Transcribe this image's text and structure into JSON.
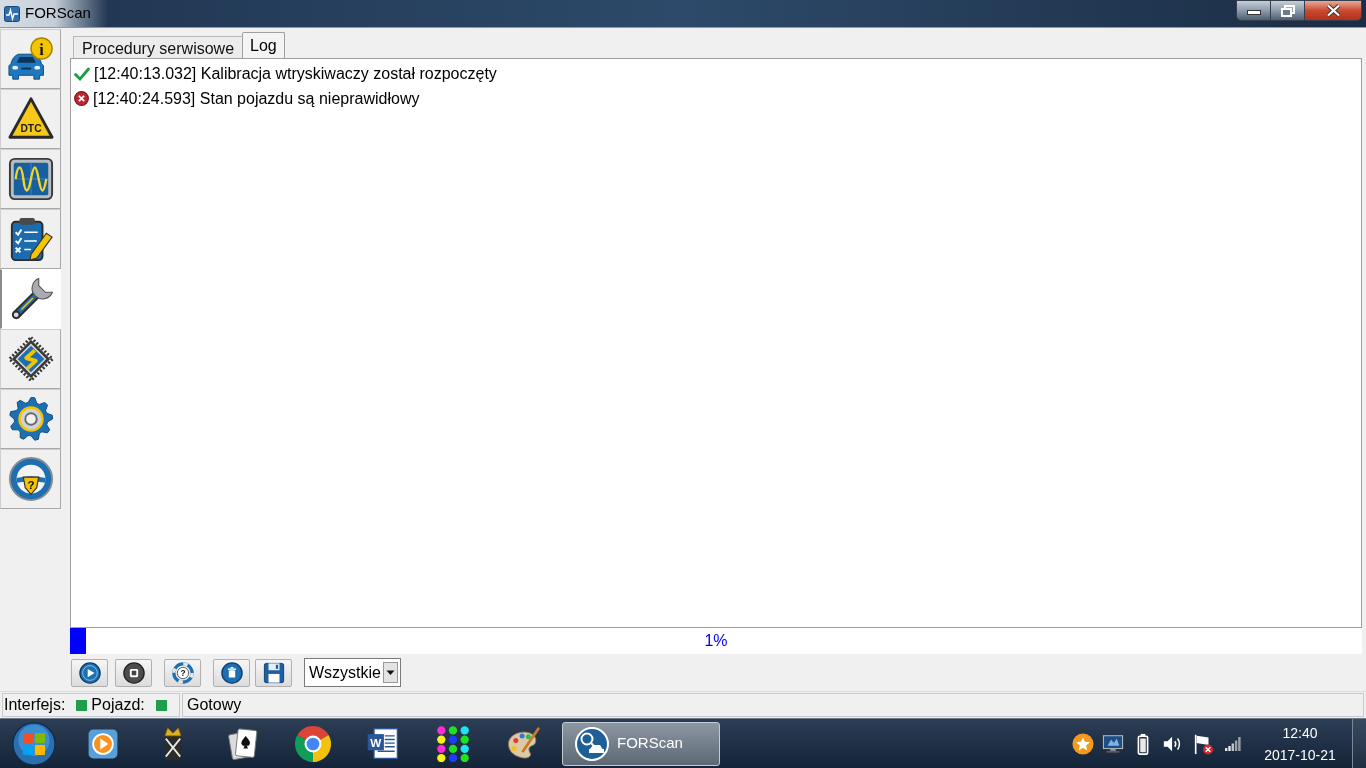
{
  "window": {
    "title": "FORScan",
    "controls": [
      {
        "kind": "minimize"
      },
      {
        "kind": "restore"
      },
      {
        "kind": "close"
      }
    ]
  },
  "sidebar": {
    "items": [
      {
        "kind": "vehicle-info",
        "glyph": "i",
        "selected": false
      },
      {
        "kind": "dtc",
        "glyph": "DTC",
        "selected": false
      },
      {
        "kind": "oscilloscope",
        "selected": false
      },
      {
        "kind": "checklist",
        "selected": false
      },
      {
        "kind": "service",
        "selected": true
      },
      {
        "kind": "module",
        "selected": false
      },
      {
        "kind": "settings",
        "selected": false
      },
      {
        "kind": "help",
        "glyph": "?",
        "selected": false
      }
    ]
  },
  "tabs": [
    {
      "label": "Procedury serwisowe",
      "selected": false
    },
    {
      "label": "Log",
      "selected": true
    }
  ],
  "log": {
    "entries": [
      {
        "kind": "success",
        "text": "[12:40:13.032] Kalibracja wtryskiwaczy został rozpoczęty"
      },
      {
        "kind": "error",
        "text": "[12:40:24.593] Stan pojazdu są nieprawidłowy"
      }
    ]
  },
  "progress": {
    "level": 0.012,
    "label": "1%"
  },
  "toolbar": {
    "buttons": [
      {
        "kind": "start"
      },
      {
        "kind": "stop"
      },
      {
        "kind": "help",
        "glyph": "?"
      },
      {
        "kind": "clear"
      },
      {
        "kind": "save"
      }
    ],
    "filter": {
      "value": "Wszystkie"
    }
  },
  "status_bar": {
    "indicators": [
      {
        "label": "Interfejs:",
        "color": "#1f9e4b"
      },
      {
        "label": "Pojazd:",
        "color": "#1f9e4b"
      }
    ],
    "message": "Gotowy"
  },
  "taskbar": {
    "pinned": [
      {
        "kind": "start"
      },
      {
        "kind": "media-player"
      },
      {
        "kind": "king-card"
      },
      {
        "kind": "cards"
      },
      {
        "kind": "browser"
      },
      {
        "kind": "document",
        "glyph": "W"
      },
      {
        "kind": "dots-game"
      },
      {
        "kind": "paint"
      }
    ],
    "windows": [
      {
        "label": "FORScan",
        "selected": true
      }
    ],
    "tray": [
      {
        "kind": "favorite"
      },
      {
        "kind": "display"
      },
      {
        "kind": "battery"
      },
      {
        "kind": "volume"
      },
      {
        "kind": "action-center"
      },
      {
        "kind": "signal"
      }
    ],
    "clock": {
      "time": "12:40",
      "date": "2017-10-21"
    }
  }
}
